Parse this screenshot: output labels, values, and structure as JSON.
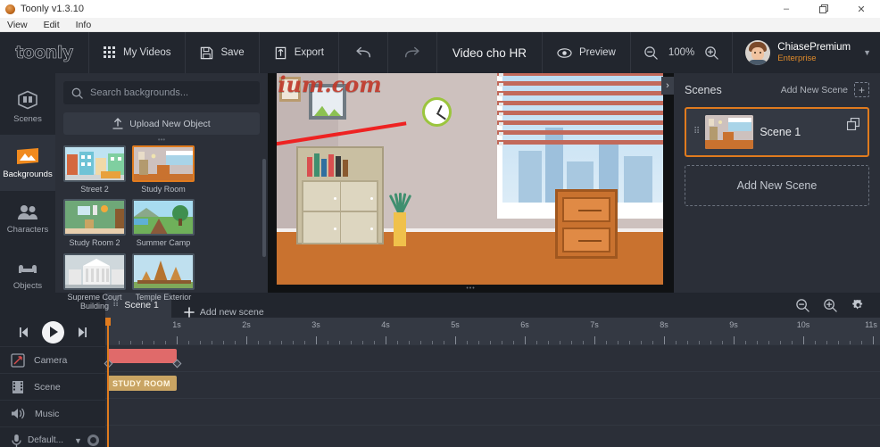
{
  "window": {
    "app_title": "Toonly v1.3.10",
    "menu": [
      "View",
      "Edit",
      "Info"
    ],
    "controls": {
      "minimize": "–",
      "maximize": "❐",
      "close": "✕"
    }
  },
  "toolbar": {
    "brand": "toonly",
    "my_videos": "My Videos",
    "save": "Save",
    "export": "Export",
    "project_title": "Video cho HR",
    "preview": "Preview",
    "zoom_level": "100%",
    "user_name": "ChiasePremium",
    "user_plan": "Enterprise"
  },
  "rail": {
    "items": [
      {
        "label": "Scenes",
        "icon": "scenes-icon",
        "active": false
      },
      {
        "label": "Backgrounds",
        "icon": "backgrounds-icon",
        "active": true
      },
      {
        "label": "Characters",
        "icon": "characters-icon",
        "active": false
      },
      {
        "label": "Objects",
        "icon": "objects-icon",
        "active": false
      }
    ]
  },
  "panel": {
    "search_placeholder": "Search backgrounds...",
    "upload_label": "Upload New Object",
    "backgrounds": [
      {
        "label": "Street 2",
        "selected": false
      },
      {
        "label": "Study Room",
        "selected": true
      },
      {
        "label": "Study Room 2",
        "selected": false
      },
      {
        "label": "Summer Camp",
        "selected": false
      },
      {
        "label": "Supreme Court Building",
        "selected": false
      },
      {
        "label": "Temple Exterior",
        "selected": false
      }
    ]
  },
  "canvas": {
    "watermark": "ChiasePremium.com",
    "collapse_chevron": "›"
  },
  "scenes_panel": {
    "title": "Scenes",
    "add_label": "Add New Scene",
    "add_icon": "+",
    "scene_name": "Scene 1",
    "add_new_scene": "Add New Scene"
  },
  "timeline": {
    "tab_label": "Scene 1",
    "add_tab_label": "Add new scene",
    "tracks": [
      {
        "label": "Camera",
        "icon": "camera-icon"
      },
      {
        "label": "Scene",
        "icon": "film-icon"
      },
      {
        "label": "Music",
        "icon": "speaker-icon"
      }
    ],
    "mic_label": "Default...",
    "camera_clip": "",
    "scene_clip": "STUDY ROOM",
    "ruler_ticks": [
      "1s",
      "2s",
      "3s",
      "4s",
      "5s",
      "6s",
      "7s",
      "8s",
      "9s",
      "10s",
      "11s"
    ]
  },
  "colors": {
    "accent": "#e07b1e",
    "panel_bg": "#2b2f38",
    "toolbar_bg": "#22262e",
    "camera_clip": "#e06a6a",
    "scene_clip": "#c9a463",
    "watermark": "#c0392b"
  }
}
